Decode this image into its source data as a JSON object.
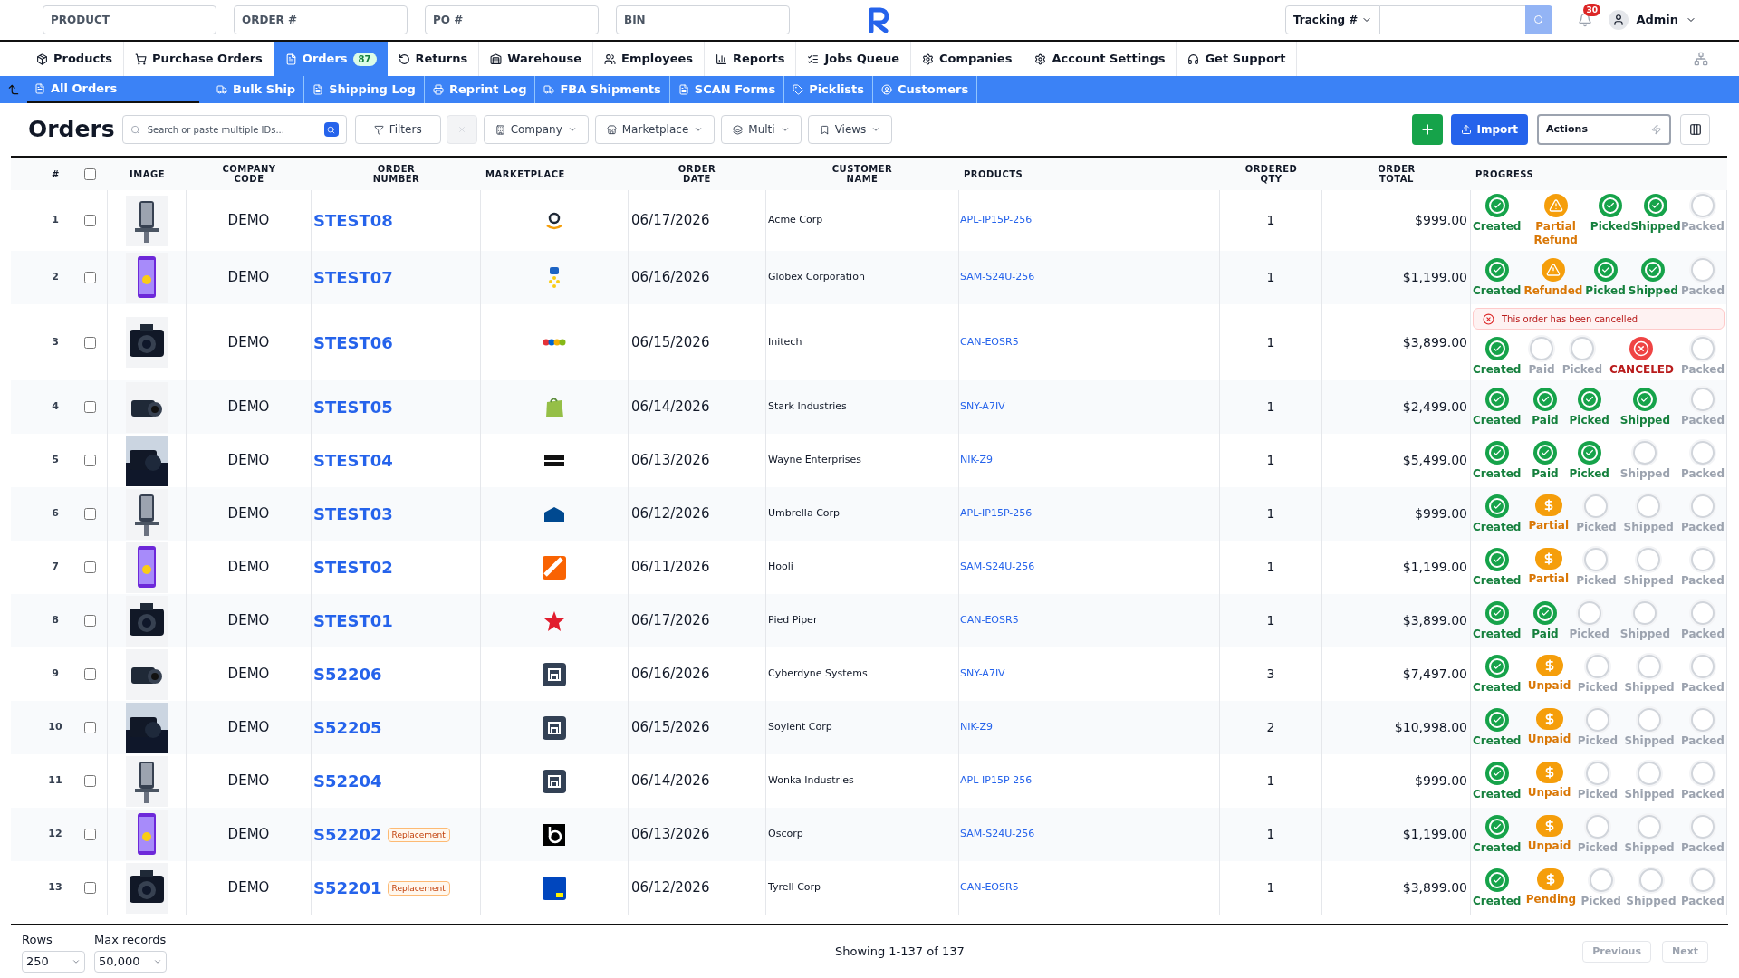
{
  "header": {
    "search_fields": [
      {
        "placeholder": "PRODUCT"
      },
      {
        "placeholder": "ORDER #"
      },
      {
        "placeholder": "PO #"
      },
      {
        "placeholder": "BIN"
      }
    ],
    "tracking": {
      "label": "Tracking #"
    },
    "notifications": "30",
    "user": "Admin"
  },
  "nav": [
    {
      "label": "Products",
      "selected": false
    },
    {
      "label": "Purchase Orders",
      "selected": false
    },
    {
      "label": "Orders",
      "selected": true,
      "badge": "87"
    },
    {
      "label": "Returns",
      "selected": false
    },
    {
      "label": "Warehouse",
      "selected": false
    },
    {
      "label": "Employees",
      "selected": false
    },
    {
      "label": "Reports",
      "selected": false
    },
    {
      "label": "Jobs Queue",
      "selected": false
    },
    {
      "label": "Companies",
      "selected": false
    },
    {
      "label": "Account Settings",
      "selected": false
    },
    {
      "label": "Get Support",
      "selected": false
    }
  ],
  "subnav": [
    {
      "label": "All Orders",
      "selected": true
    },
    {
      "label": "Bulk Ship",
      "selected": false
    },
    {
      "label": "Shipping Log",
      "selected": false
    },
    {
      "label": "Reprint Log",
      "selected": false
    },
    {
      "label": "FBA Shipments",
      "selected": false
    },
    {
      "label": "SCAN Forms",
      "selected": false
    },
    {
      "label": "Picklists",
      "selected": false
    },
    {
      "label": "Customers",
      "selected": false
    }
  ],
  "toolbar": {
    "title": "Orders",
    "search": {
      "placeholder": "Search or paste multiple IDs..."
    },
    "filters": "Filters",
    "clear": {
      "disabled": true
    },
    "dropdowns": [
      "Company",
      "Marketplace",
      "Multi",
      "Views"
    ],
    "import": "Import",
    "actions": "Actions"
  },
  "table": {
    "columns": [
      "#",
      "IMAGE",
      "COMPANY CODE",
      "ORDER NUMBER",
      "MARKETPLACE",
      "ORDER DATE",
      "CUSTOMER NAME",
      "PRODUCTS",
      "ORDERED QTY",
      "ORDER TOTAL",
      "PROGRESS"
    ],
    "select_all": {
      "checked": false
    },
    "rows": [
      {
        "num": "1",
        "selected": false,
        "company": "DEMO",
        "order": "STEST08",
        "marketplace": {
          "kind": "amazon"
        },
        "date": "06/17/2026",
        "customer": "Acme Corp",
        "product": "APL-IP15P-256",
        "qty": "1",
        "total": "$999.00",
        "steps": [
          {
            "label": "Created",
            "kind": "done"
          },
          {
            "label": "Partial Refund",
            "kind": "warn"
          },
          {
            "label": "Picked",
            "kind": "done"
          },
          {
            "label": "Shipped",
            "kind": "done"
          },
          {
            "label": "Packed",
            "kind": "todo"
          }
        ]
      },
      {
        "num": "2",
        "selected": false,
        "company": "DEMO",
        "order": "STEST07",
        "marketplace": {
          "kind": "walmart"
        },
        "date": "06/16/2026",
        "customer": "Globex Corporation",
        "product": "SAM-S24U-256",
        "qty": "1",
        "total": "$1,199.00",
        "steps": [
          {
            "label": "Created",
            "kind": "done"
          },
          {
            "label": "Refunded",
            "kind": "warn"
          },
          {
            "label": "Picked",
            "kind": "done"
          },
          {
            "label": "Shipped",
            "kind": "done"
          },
          {
            "label": "Packed",
            "kind": "todo"
          }
        ]
      },
      {
        "num": "3",
        "selected": false,
        "company": "DEMO",
        "order": "STEST06",
        "marketplace": {
          "kind": "ebay"
        },
        "date": "06/15/2026",
        "customer": "Initech",
        "product": "CAN-EOSR5",
        "qty": "1",
        "total": "$3,899.00",
        "notice": "This order has been cancelled",
        "steps": [
          {
            "label": "Created",
            "kind": "done"
          },
          {
            "label": "Paid",
            "kind": "todo"
          },
          {
            "label": "Picked",
            "kind": "todo"
          },
          {
            "label": "CANCELED",
            "kind": "cancel"
          },
          {
            "label": "Packed",
            "kind": "todo"
          }
        ]
      },
      {
        "num": "4",
        "selected": false,
        "company": "DEMO",
        "order": "STEST05",
        "marketplace": {
          "kind": "shopify"
        },
        "date": "06/14/2026",
        "customer": "Stark Industries",
        "product": "SNY-A7IV",
        "qty": "1",
        "total": "$2,499.00",
        "steps": [
          {
            "label": "Created",
            "kind": "done"
          },
          {
            "label": "Paid",
            "kind": "done"
          },
          {
            "label": "Picked",
            "kind": "done"
          },
          {
            "label": "Shipped",
            "kind": "done"
          },
          {
            "label": "Packed",
            "kind": "todo"
          }
        ]
      },
      {
        "num": "5",
        "selected": false,
        "company": "DEMO",
        "order": "STEST04",
        "marketplace": {
          "kind": "backmarket"
        },
        "date": "06/13/2026",
        "customer": "Wayne Enterprises",
        "product": "NIK-Z9",
        "qty": "1",
        "total": "$5,499.00",
        "steps": [
          {
            "label": "Created",
            "kind": "done"
          },
          {
            "label": "Paid",
            "kind": "done"
          },
          {
            "label": "Picked",
            "kind": "done"
          },
          {
            "label": "Shipped",
            "kind": "todo"
          },
          {
            "label": "Packed",
            "kind": "todo"
          }
        ]
      },
      {
        "num": "6",
        "selected": false,
        "company": "DEMO",
        "order": "STEST03",
        "marketplace": {
          "kind": "lowes"
        },
        "date": "06/12/2026",
        "customer": "Umbrella Corp",
        "product": "APL-IP15P-256",
        "qty": "1",
        "total": "$999.00",
        "steps": [
          {
            "label": "Created",
            "kind": "done"
          },
          {
            "label": "Partial",
            "kind": "dollar"
          },
          {
            "label": "Picked",
            "kind": "todo"
          },
          {
            "label": "Shipped",
            "kind": "todo"
          },
          {
            "label": "Packed",
            "kind": "todo"
          }
        ]
      },
      {
        "num": "7",
        "selected": false,
        "company": "DEMO",
        "order": "STEST02",
        "marketplace": {
          "kind": "homedepot"
        },
        "date": "06/11/2026",
        "customer": "Hooli",
        "product": "SAM-S24U-256",
        "qty": "1",
        "total": "$1,199.00",
        "steps": [
          {
            "label": "Created",
            "kind": "done"
          },
          {
            "label": "Partial",
            "kind": "dollar"
          },
          {
            "label": "Picked",
            "kind": "todo"
          },
          {
            "label": "Shipped",
            "kind": "todo"
          },
          {
            "label": "Packed",
            "kind": "todo"
          }
        ]
      },
      {
        "num": "8",
        "selected": false,
        "company": "DEMO",
        "order": "STEST01",
        "marketplace": {
          "kind": "star"
        },
        "date": "06/17/2026",
        "customer": "Pied Piper",
        "product": "CAN-EOSR5",
        "qty": "1",
        "total": "$3,899.00",
        "steps": [
          {
            "label": "Created",
            "kind": "done"
          },
          {
            "label": "Paid",
            "kind": "done"
          },
          {
            "label": "Picked",
            "kind": "todo"
          },
          {
            "label": "Shipped",
            "kind": "todo"
          },
          {
            "label": "Packed",
            "kind": "todo"
          }
        ]
      },
      {
        "num": "9",
        "selected": false,
        "company": "DEMO",
        "order": "S52206",
        "marketplace": {
          "kind": "store"
        },
        "date": "06/16/2026",
        "customer": "Cyberdyne Systems",
        "product": "SNY-A7IV",
        "qty": "3",
        "total": "$7,497.00",
        "steps": [
          {
            "label": "Created",
            "kind": "done"
          },
          {
            "label": "Unpaid",
            "kind": "dollar"
          },
          {
            "label": "Picked",
            "kind": "todo"
          },
          {
            "label": "Shipped",
            "kind": "todo"
          },
          {
            "label": "Packed",
            "kind": "todo"
          }
        ]
      },
      {
        "num": "10",
        "selected": false,
        "company": "DEMO",
        "order": "S52205",
        "marketplace": {
          "kind": "store"
        },
        "date": "06/15/2026",
        "customer": "Soylent Corp",
        "product": "NIK-Z9",
        "qty": "2",
        "total": "$10,998.00",
        "steps": [
          {
            "label": "Created",
            "kind": "done"
          },
          {
            "label": "Unpaid",
            "kind": "dollar"
          },
          {
            "label": "Picked",
            "kind": "todo"
          },
          {
            "label": "Shipped",
            "kind": "todo"
          },
          {
            "label": "Packed",
            "kind": "todo"
          }
        ]
      },
      {
        "num": "11",
        "selected": false,
        "company": "DEMO",
        "order": "S52204",
        "marketplace": {
          "kind": "store"
        },
        "date": "06/14/2026",
        "customer": "Wonka Industries",
        "product": "APL-IP15P-256",
        "qty": "1",
        "total": "$999.00",
        "steps": [
          {
            "label": "Created",
            "kind": "done"
          },
          {
            "label": "Unpaid",
            "kind": "dollar"
          },
          {
            "label": "Picked",
            "kind": "todo"
          },
          {
            "label": "Shipped",
            "kind": "todo"
          },
          {
            "label": "Packed",
            "kind": "todo"
          }
        ]
      },
      {
        "num": "12",
        "selected": false,
        "company": "DEMO",
        "order": "S52202",
        "badge": "Replacement",
        "marketplace": {
          "kind": "ring"
        },
        "date": "06/13/2026",
        "customer": "Oscorp",
        "product": "SAM-S24U-256",
        "qty": "1",
        "total": "$1,199.00",
        "steps": [
          {
            "label": "Created",
            "kind": "done"
          },
          {
            "label": "Unpaid",
            "kind": "dollar"
          },
          {
            "label": "Picked",
            "kind": "todo"
          },
          {
            "label": "Shipped",
            "kind": "todo"
          },
          {
            "label": "Packed",
            "kind": "todo"
          }
        ]
      },
      {
        "num": "13",
        "selected": false,
        "company": "DEMO",
        "order": "S52201",
        "badge": "Replacement",
        "marketplace": {
          "kind": "tag"
        },
        "date": "06/12/2026",
        "customer": "Tyrell Corp",
        "product": "CAN-EOSR5",
        "qty": "1",
        "total": "$3,899.00",
        "steps": [
          {
            "label": "Created",
            "kind": "done"
          },
          {
            "label": "Pending",
            "kind": "dollar"
          },
          {
            "label": "Picked",
            "kind": "todo"
          },
          {
            "label": "Shipped",
            "kind": "todo"
          },
          {
            "label": "Packed",
            "kind": "todo"
          }
        ]
      }
    ]
  },
  "footer": {
    "rows_label": "Rows",
    "rows_value": "250",
    "max_label": "Max records",
    "max_value": "50,000",
    "showing": "Showing 1-137 of 137",
    "previous": {
      "label": "Previous",
      "disabled": true
    },
    "next": {
      "label": "Next",
      "disabled": true
    }
  }
}
